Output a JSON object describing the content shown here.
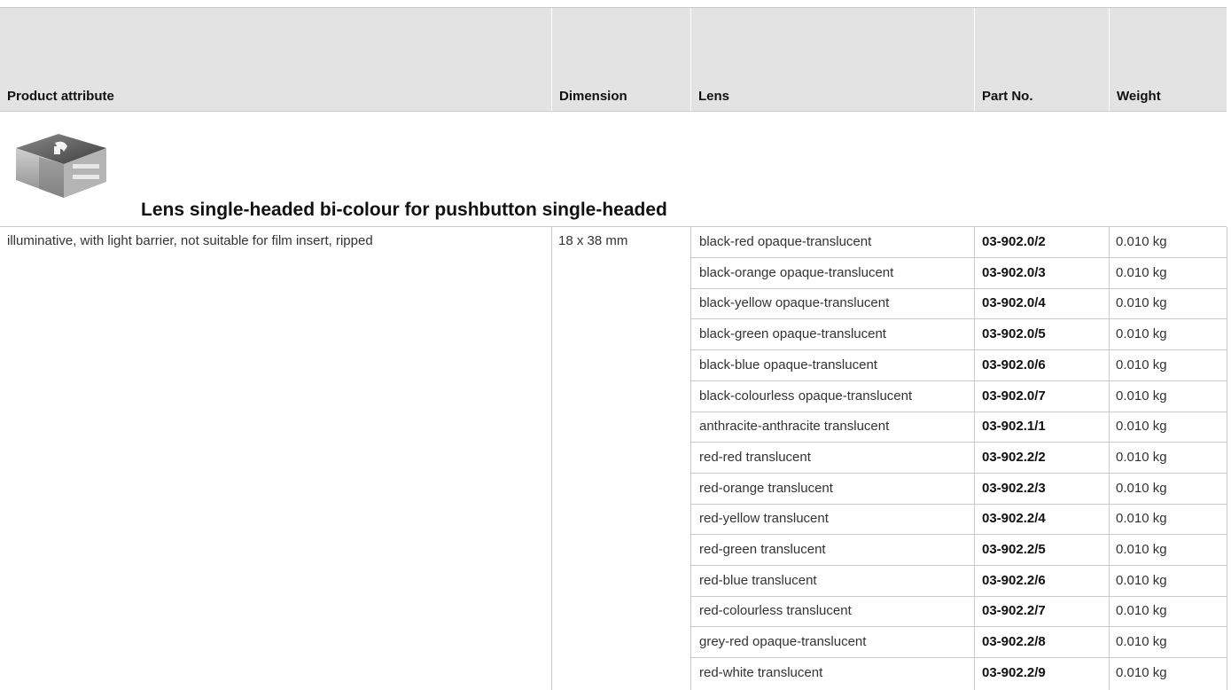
{
  "header": {
    "col_attribute": "Product attribute",
    "col_dimension": "Dimension",
    "col_lens": "Lens",
    "col_part": "Part No.",
    "col_weight": "Weight"
  },
  "product": {
    "image_icon": "lens-product-icon",
    "title": "Lens single-headed bi-colour for pushbutton single-headed",
    "attribute": "illuminative, with light barrier, not suitable for film insert, ripped",
    "dimension": "18 x 38 mm"
  },
  "rows": [
    {
      "lens": "black-red opaque-translucent",
      "part": "03-902.0/2",
      "weight": "0.010 kg"
    },
    {
      "lens": "black-orange opaque-translucent",
      "part": "03-902.0/3",
      "weight": "0.010 kg"
    },
    {
      "lens": "black-yellow opaque-translucent",
      "part": "03-902.0/4",
      "weight": "0.010 kg"
    },
    {
      "lens": "black-green opaque-translucent",
      "part": "03-902.0/5",
      "weight": "0.010 kg"
    },
    {
      "lens": "black-blue opaque-translucent",
      "part": "03-902.0/6",
      "weight": "0.010 kg"
    },
    {
      "lens": "black-colourless opaque-translucent",
      "part": "03-902.0/7",
      "weight": "0.010 kg"
    },
    {
      "lens": "anthracite-anthracite translucent",
      "part": "03-902.1/1",
      "weight": "0.010 kg"
    },
    {
      "lens": "red-red translucent",
      "part": "03-902.2/2",
      "weight": "0.010 kg"
    },
    {
      "lens": "red-orange translucent",
      "part": "03-902.2/3",
      "weight": "0.010 kg"
    },
    {
      "lens": "red-yellow translucent",
      "part": "03-902.2/4",
      "weight": "0.010 kg"
    },
    {
      "lens": "red-green translucent",
      "part": "03-902.2/5",
      "weight": "0.010 kg"
    },
    {
      "lens": "red-blue translucent",
      "part": "03-902.2/6",
      "weight": "0.010 kg"
    },
    {
      "lens": "red-colourless translucent",
      "part": "03-902.2/7",
      "weight": "0.010 kg"
    },
    {
      "lens": "grey-red opaque-translucent",
      "part": "03-902.2/8",
      "weight": "0.010 kg"
    },
    {
      "lens": "red-white translucent",
      "part": "03-902.2/9",
      "weight": "0.010 kg"
    }
  ]
}
